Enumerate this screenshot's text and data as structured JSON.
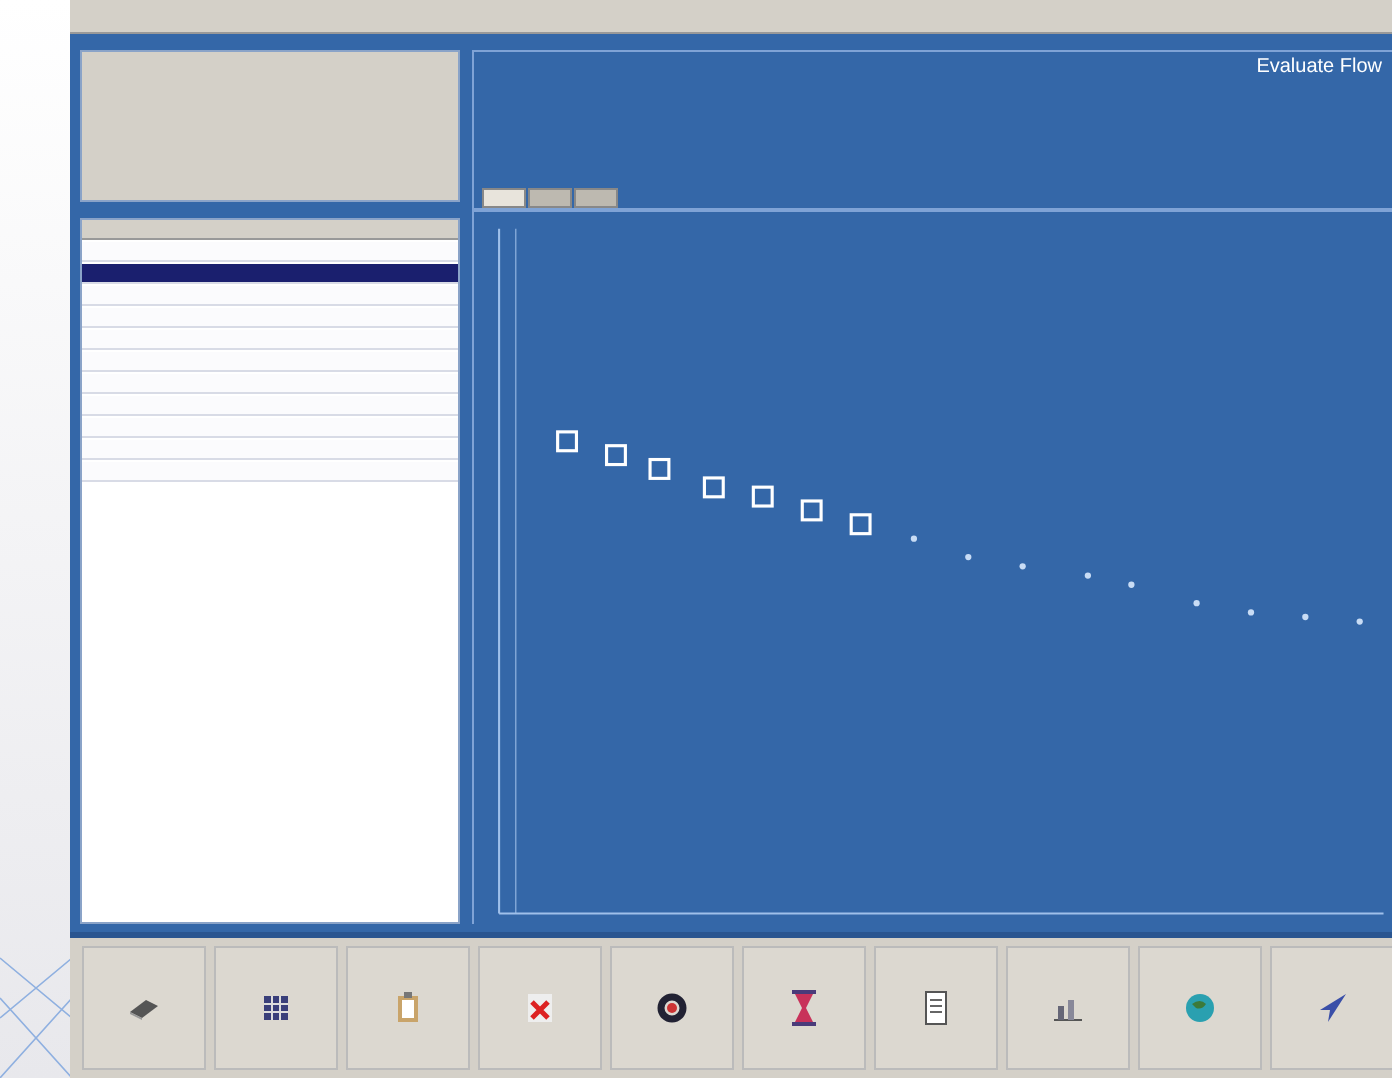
{
  "header": {
    "title": "Evaluate Flow"
  },
  "tabs": [
    {
      "selected": true
    },
    {
      "selected": false
    },
    {
      "selected": false
    }
  ],
  "list": {
    "rows": [
      {
        "selected": false
      },
      {
        "selected": true
      },
      {
        "selected": false
      },
      {
        "selected": false
      },
      {
        "selected": false
      },
      {
        "selected": false
      },
      {
        "selected": false
      },
      {
        "selected": false
      },
      {
        "selected": false
      },
      {
        "selected": false
      },
      {
        "selected": false
      }
    ]
  },
  "toolbar": [
    {
      "kind": "eraser"
    },
    {
      "kind": "grid"
    },
    {
      "kind": "clipboard"
    },
    {
      "kind": "delete"
    },
    {
      "kind": "ring"
    },
    {
      "kind": "hourglass"
    },
    {
      "kind": "document"
    },
    {
      "kind": "chart"
    },
    {
      "kind": "globe"
    },
    {
      "kind": "arrow"
    }
  ]
}
